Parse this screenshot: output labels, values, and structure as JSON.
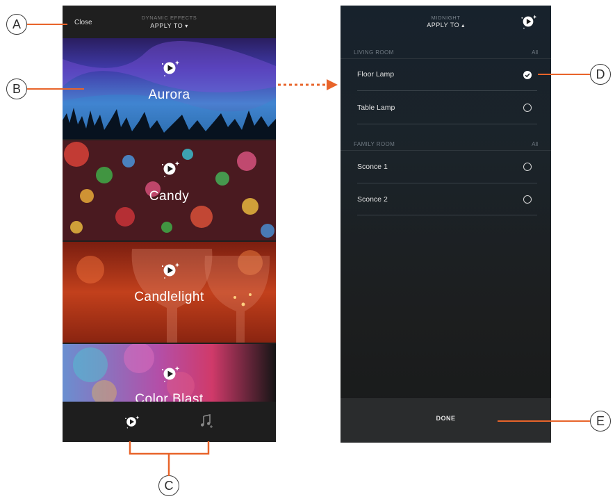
{
  "callouts": {
    "a": "A",
    "b": "B",
    "c": "C",
    "d": "D",
    "e": "E"
  },
  "left_screen": {
    "close_label": "Close",
    "header_subtitle": "DYNAMIC EFFECTS",
    "apply_to_label": "APPLY TO",
    "apply_to_chevron": "▾",
    "effects": [
      {
        "name": "Aurora",
        "icon": "dynamic-effect-play-icon"
      },
      {
        "name": "Candy",
        "icon": "dynamic-effect-play-icon"
      },
      {
        "name": "Candlelight",
        "icon": "dynamic-effect-play-icon"
      },
      {
        "name": "Color Blast",
        "icon": "dynamic-effect-play-icon"
      }
    ],
    "bottom_tabs": [
      {
        "icon": "dynamic-effects-tab-icon"
      },
      {
        "icon": "music-sync-tab-icon"
      }
    ]
  },
  "right_screen": {
    "header_subtitle": "MIDNIGHT",
    "apply_to_label": "APPLY TO",
    "apply_to_chevron": "▴",
    "rooms": [
      {
        "name": "LIVING ROOM",
        "all_label": "All",
        "lights": [
          {
            "name": "Floor Lamp",
            "selected": true
          },
          {
            "name": "Table Lamp",
            "selected": false
          }
        ]
      },
      {
        "name": "FAMILY ROOM",
        "all_label": "All",
        "lights": [
          {
            "name": "Sconce 1",
            "selected": false
          },
          {
            "name": "Sconce 2",
            "selected": false
          }
        ]
      }
    ],
    "done_label": "DONE"
  },
  "colors": {
    "accent": "#e8642a"
  }
}
